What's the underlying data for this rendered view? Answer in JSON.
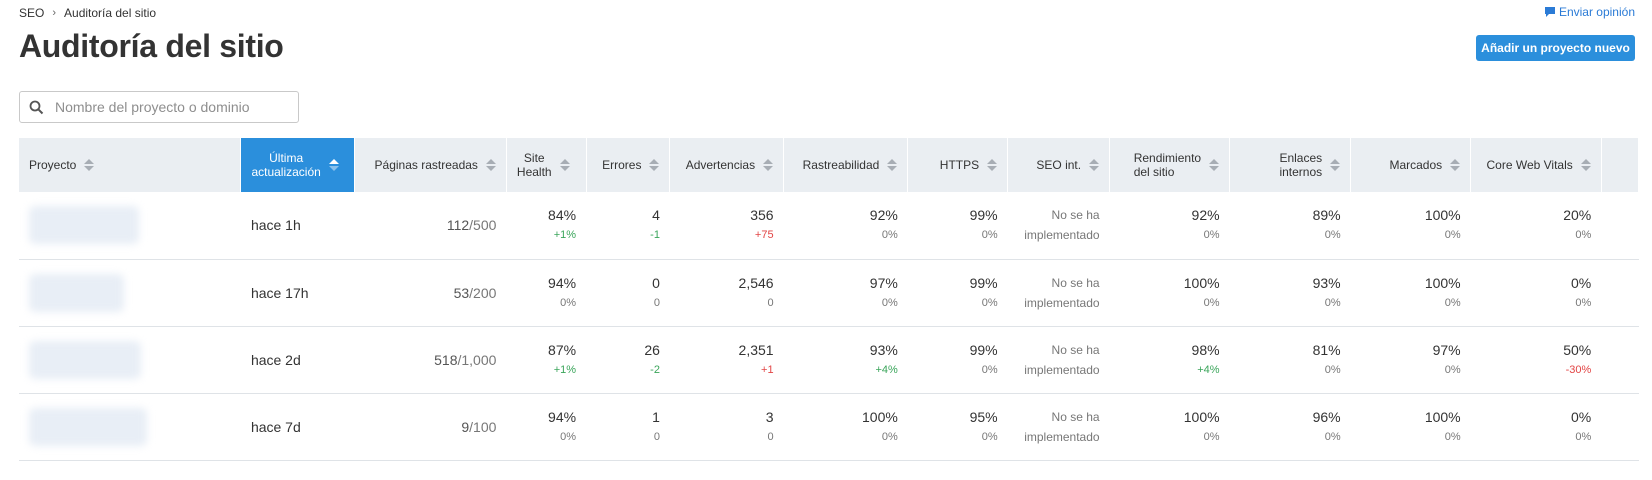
{
  "breadcrumb": {
    "root": "SEO",
    "current": "Auditoría del sitio"
  },
  "feedback_label": "Enviar opinión",
  "page_title": "Auditoría del sitio",
  "add_project_label": "Añadir un proyecto nuevo",
  "search": {
    "placeholder": "Nombre del proyecto o dominio",
    "value": ""
  },
  "colors": {
    "accent": "#2b8fdc",
    "positive": "#3aa55a",
    "negative": "#e24545",
    "header_bg": "#eaeef2"
  },
  "columns": {
    "project": "Proyecto",
    "last_update_line1": "Última",
    "last_update_line2": "actualización",
    "pages": "Páginas rastreadas",
    "health_line1": "Site",
    "health_line2": "Health",
    "errors": "Errores",
    "warnings": "Advertencias",
    "crawlability": "Rastreabilidad",
    "https": "HTTPS",
    "intl_seo": "SEO int.",
    "performance_line1": "Rendimiento",
    "performance_line2": "del sitio",
    "internal_links_line1": "Enlaces",
    "internal_links_line2": "internos",
    "markup": "Marcados",
    "cwv": "Core Web Vitals"
  },
  "rows": [
    {
      "updated": "hace 1h",
      "pages_crawled": "112",
      "pages_limit": "/500",
      "health": "84%",
      "health_delta": "+1%",
      "errors": "4",
      "errors_delta": "-1",
      "warnings": "356",
      "warnings_delta": "+75",
      "crawl": "92%",
      "crawl_delta": "0%",
      "https": "99%",
      "https_delta": "0%",
      "intl_line1": "No se ha",
      "intl_line2": "implementado",
      "perf": "92%",
      "perf_delta": "0%",
      "links": "89%",
      "links_delta": "0%",
      "markup": "100%",
      "markup_delta": "0%",
      "cwv": "20%",
      "cwv_delta": "0%"
    },
    {
      "updated": "hace 17h",
      "pages_crawled": "53",
      "pages_limit": "/200",
      "health": "94%",
      "health_delta": "0%",
      "errors": "0",
      "errors_delta": "0",
      "warnings": "2,546",
      "warnings_delta": "0",
      "crawl": "97%",
      "crawl_delta": "0%",
      "https": "99%",
      "https_delta": "0%",
      "intl_line1": "No se ha",
      "intl_line2": "implementado",
      "perf": "100%",
      "perf_delta": "0%",
      "links": "93%",
      "links_delta": "0%",
      "markup": "100%",
      "markup_delta": "0%",
      "cwv": "0%",
      "cwv_delta": "0%"
    },
    {
      "updated": "hace 2d",
      "pages_crawled": "518",
      "pages_limit": "/1,000",
      "health": "87%",
      "health_delta": "+1%",
      "errors": "26",
      "errors_delta": "-2",
      "warnings": "2,351",
      "warnings_delta": "+1",
      "crawl": "93%",
      "crawl_delta": "+4%",
      "https": "99%",
      "https_delta": "0%",
      "intl_line1": "No se ha",
      "intl_line2": "implementado",
      "perf": "98%",
      "perf_delta": "+4%",
      "links": "81%",
      "links_delta": "0%",
      "markup": "97%",
      "markup_delta": "0%",
      "cwv": "50%",
      "cwv_delta": "-30%"
    },
    {
      "updated": "hace 7d",
      "pages_crawled": "9",
      "pages_limit": "/100",
      "health": "94%",
      "health_delta": "0%",
      "errors": "1",
      "errors_delta": "0",
      "warnings": "3",
      "warnings_delta": "0",
      "crawl": "100%",
      "crawl_delta": "0%",
      "https": "95%",
      "https_delta": "0%",
      "intl_line1": "No se ha",
      "intl_line2": "implementado",
      "perf": "100%",
      "perf_delta": "0%",
      "links": "96%",
      "links_delta": "0%",
      "markup": "100%",
      "markup_delta": "0%",
      "cwv": "0%",
      "cwv_delta": "0%"
    }
  ]
}
